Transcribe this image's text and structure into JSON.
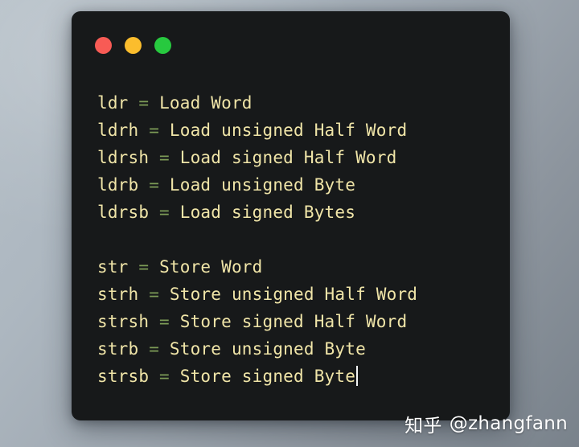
{
  "window": {
    "titlebar": {
      "buttons": [
        {
          "name": "close-button",
          "label": "Close",
          "color": "#f85b55"
        },
        {
          "name": "minimize-button",
          "label": "Minimize",
          "color": "#fbbd2d"
        },
        {
          "name": "maximize-button",
          "label": "Maximize",
          "color": "#27c93f"
        }
      ]
    },
    "background_color": "#17191a",
    "text_color": "#f0e5a8",
    "operator_color": "#7d9c57",
    "cursor_color": "#f2f4f5"
  },
  "editor": {
    "lines": [
      {
        "mnemonic": "ldr",
        "operator": " = ",
        "description": "Load Word"
      },
      {
        "mnemonic": "ldrh",
        "operator": " = ",
        "description": "Load unsigned Half Word"
      },
      {
        "mnemonic": "ldrsh",
        "operator": " = ",
        "description": "Load signed Half Word"
      },
      {
        "mnemonic": "ldrb",
        "operator": " = ",
        "description": "Load unsigned Byte"
      },
      {
        "mnemonic": "ldrsb",
        "operator": " = ",
        "description": "Load signed Bytes"
      },
      {
        "mnemonic": "",
        "operator": "",
        "description": ""
      },
      {
        "mnemonic": "str",
        "operator": " = ",
        "description": "Store Word"
      },
      {
        "mnemonic": "strh",
        "operator": " = ",
        "description": "Store unsigned Half Word"
      },
      {
        "mnemonic": "strsh",
        "operator": " = ",
        "description": "Store signed Half Word"
      },
      {
        "mnemonic": "strb",
        "operator": " = ",
        "description": "Store unsigned Byte"
      },
      {
        "mnemonic": "strsb",
        "operator": " = ",
        "description": "Store signed Byte"
      }
    ],
    "cursor_line_index": 10
  },
  "watermark": {
    "logo": "知乎",
    "handle": "@zhangfann"
  },
  "desktop": {
    "gradient_from": "#b6c0c8",
    "gradient_to": "#79828b"
  }
}
